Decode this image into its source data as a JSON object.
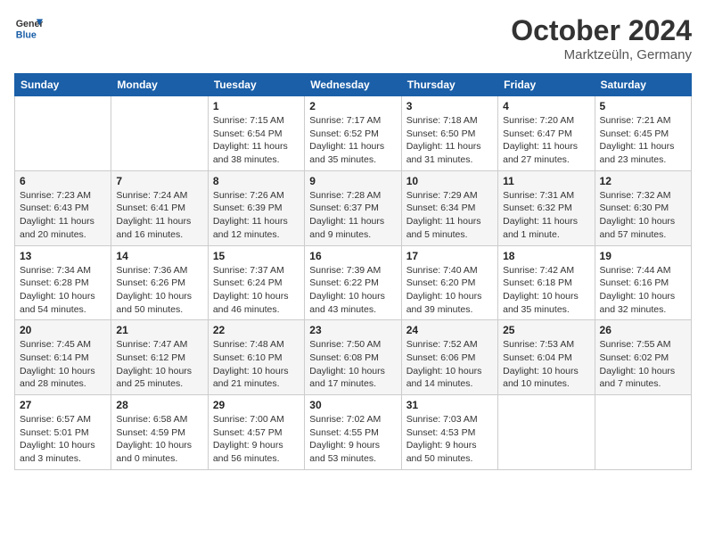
{
  "header": {
    "logo_line1": "General",
    "logo_line2": "Blue",
    "month_year": "October 2024",
    "location": "Marktzeüln, Germany"
  },
  "days_of_week": [
    "Sunday",
    "Monday",
    "Tuesday",
    "Wednesday",
    "Thursday",
    "Friday",
    "Saturday"
  ],
  "weeks": [
    [
      {
        "day": "",
        "info": ""
      },
      {
        "day": "",
        "info": ""
      },
      {
        "day": "1",
        "info": "Sunrise: 7:15 AM\nSunset: 6:54 PM\nDaylight: 11 hours and 38 minutes."
      },
      {
        "day": "2",
        "info": "Sunrise: 7:17 AM\nSunset: 6:52 PM\nDaylight: 11 hours and 35 minutes."
      },
      {
        "day": "3",
        "info": "Sunrise: 7:18 AM\nSunset: 6:50 PM\nDaylight: 11 hours and 31 minutes."
      },
      {
        "day": "4",
        "info": "Sunrise: 7:20 AM\nSunset: 6:47 PM\nDaylight: 11 hours and 27 minutes."
      },
      {
        "day": "5",
        "info": "Sunrise: 7:21 AM\nSunset: 6:45 PM\nDaylight: 11 hours and 23 minutes."
      }
    ],
    [
      {
        "day": "6",
        "info": "Sunrise: 7:23 AM\nSunset: 6:43 PM\nDaylight: 11 hours and 20 minutes."
      },
      {
        "day": "7",
        "info": "Sunrise: 7:24 AM\nSunset: 6:41 PM\nDaylight: 11 hours and 16 minutes."
      },
      {
        "day": "8",
        "info": "Sunrise: 7:26 AM\nSunset: 6:39 PM\nDaylight: 11 hours and 12 minutes."
      },
      {
        "day": "9",
        "info": "Sunrise: 7:28 AM\nSunset: 6:37 PM\nDaylight: 11 hours and 9 minutes."
      },
      {
        "day": "10",
        "info": "Sunrise: 7:29 AM\nSunset: 6:34 PM\nDaylight: 11 hours and 5 minutes."
      },
      {
        "day": "11",
        "info": "Sunrise: 7:31 AM\nSunset: 6:32 PM\nDaylight: 11 hours and 1 minute."
      },
      {
        "day": "12",
        "info": "Sunrise: 7:32 AM\nSunset: 6:30 PM\nDaylight: 10 hours and 57 minutes."
      }
    ],
    [
      {
        "day": "13",
        "info": "Sunrise: 7:34 AM\nSunset: 6:28 PM\nDaylight: 10 hours and 54 minutes."
      },
      {
        "day": "14",
        "info": "Sunrise: 7:36 AM\nSunset: 6:26 PM\nDaylight: 10 hours and 50 minutes."
      },
      {
        "day": "15",
        "info": "Sunrise: 7:37 AM\nSunset: 6:24 PM\nDaylight: 10 hours and 46 minutes."
      },
      {
        "day": "16",
        "info": "Sunrise: 7:39 AM\nSunset: 6:22 PM\nDaylight: 10 hours and 43 minutes."
      },
      {
        "day": "17",
        "info": "Sunrise: 7:40 AM\nSunset: 6:20 PM\nDaylight: 10 hours and 39 minutes."
      },
      {
        "day": "18",
        "info": "Sunrise: 7:42 AM\nSunset: 6:18 PM\nDaylight: 10 hours and 35 minutes."
      },
      {
        "day": "19",
        "info": "Sunrise: 7:44 AM\nSunset: 6:16 PM\nDaylight: 10 hours and 32 minutes."
      }
    ],
    [
      {
        "day": "20",
        "info": "Sunrise: 7:45 AM\nSunset: 6:14 PM\nDaylight: 10 hours and 28 minutes."
      },
      {
        "day": "21",
        "info": "Sunrise: 7:47 AM\nSunset: 6:12 PM\nDaylight: 10 hours and 25 minutes."
      },
      {
        "day": "22",
        "info": "Sunrise: 7:48 AM\nSunset: 6:10 PM\nDaylight: 10 hours and 21 minutes."
      },
      {
        "day": "23",
        "info": "Sunrise: 7:50 AM\nSunset: 6:08 PM\nDaylight: 10 hours and 17 minutes."
      },
      {
        "day": "24",
        "info": "Sunrise: 7:52 AM\nSunset: 6:06 PM\nDaylight: 10 hours and 14 minutes."
      },
      {
        "day": "25",
        "info": "Sunrise: 7:53 AM\nSunset: 6:04 PM\nDaylight: 10 hours and 10 minutes."
      },
      {
        "day": "26",
        "info": "Sunrise: 7:55 AM\nSunset: 6:02 PM\nDaylight: 10 hours and 7 minutes."
      }
    ],
    [
      {
        "day": "27",
        "info": "Sunrise: 6:57 AM\nSunset: 5:01 PM\nDaylight: 10 hours and 3 minutes."
      },
      {
        "day": "28",
        "info": "Sunrise: 6:58 AM\nSunset: 4:59 PM\nDaylight: 10 hours and 0 minutes."
      },
      {
        "day": "29",
        "info": "Sunrise: 7:00 AM\nSunset: 4:57 PM\nDaylight: 9 hours and 56 minutes."
      },
      {
        "day": "30",
        "info": "Sunrise: 7:02 AM\nSunset: 4:55 PM\nDaylight: 9 hours and 53 minutes."
      },
      {
        "day": "31",
        "info": "Sunrise: 7:03 AM\nSunset: 4:53 PM\nDaylight: 9 hours and 50 minutes."
      },
      {
        "day": "",
        "info": ""
      },
      {
        "day": "",
        "info": ""
      }
    ]
  ]
}
